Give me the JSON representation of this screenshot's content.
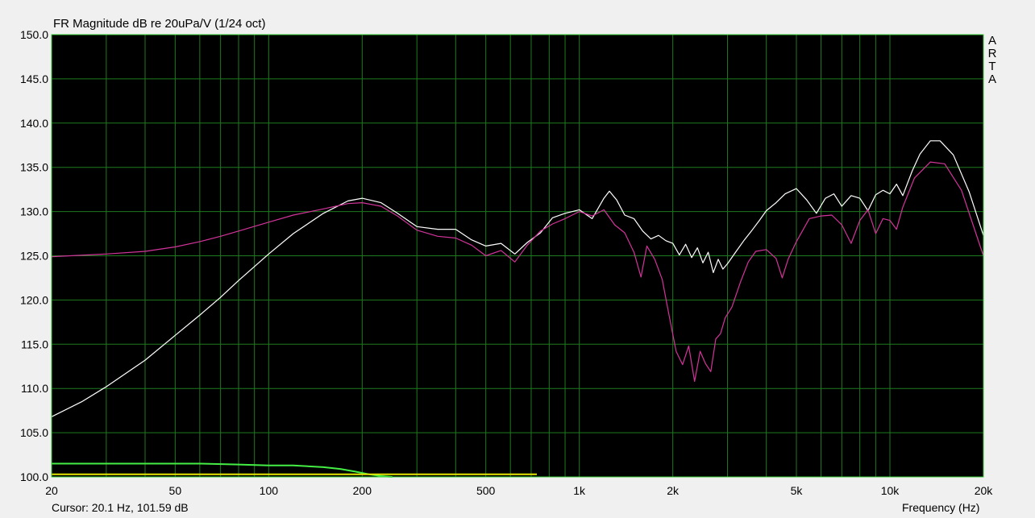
{
  "watermark": "ARTA",
  "cursor_readout": "Cursor: 20.1 Hz, 101.59 dB",
  "colors": {
    "background": "#000000",
    "grid": "#1e7a1e",
    "frame": "#33cc33",
    "series_white": "#ffffff",
    "series_magenta": "#d2349a",
    "coherence_green": "#44ee44",
    "coherence_yellow": "#e6e600"
  },
  "chart_data": {
    "type": "line",
    "title": "FR Magnitude dB re 20uPa/V (1/24 oct)",
    "xlabel": "Frequency (Hz)",
    "ylabel": "",
    "xscale": "log",
    "xlim": [
      20,
      20000
    ],
    "ylim": [
      100,
      150
    ],
    "grid": true,
    "x_ticks": [
      20,
      50,
      100,
      200,
      500,
      1000,
      2000,
      5000,
      10000,
      20000
    ],
    "x_tick_labels": [
      "20",
      "50",
      "100",
      "200",
      "500",
      "1k",
      "2k",
      "5k",
      "10k",
      "20k"
    ],
    "y_ticks": [
      100,
      105,
      110,
      115,
      120,
      125,
      130,
      135,
      140,
      145,
      150
    ],
    "y_tick_labels": [
      "100.0",
      "105.0",
      "110.0",
      "115.0",
      "120.0",
      "125.0",
      "130.0",
      "135.0",
      "140.0",
      "145.0",
      "150.0"
    ],
    "series": [
      {
        "color": "#ffffff",
        "points": [
          [
            20,
            106.8
          ],
          [
            25,
            108.5
          ],
          [
            30,
            110.2
          ],
          [
            40,
            113.2
          ],
          [
            50,
            116.0
          ],
          [
            60,
            118.3
          ],
          [
            70,
            120.3
          ],
          [
            80,
            122.2
          ],
          [
            100,
            125.2
          ],
          [
            120,
            127.5
          ],
          [
            150,
            129.8
          ],
          [
            180,
            131.2
          ],
          [
            200,
            131.5
          ],
          [
            230,
            131.0
          ],
          [
            260,
            129.8
          ],
          [
            300,
            128.3
          ],
          [
            350,
            128.0
          ],
          [
            400,
            128.0
          ],
          [
            450,
            126.8
          ],
          [
            500,
            126.1
          ],
          [
            560,
            126.4
          ],
          [
            620,
            125.2
          ],
          [
            680,
            126.5
          ],
          [
            750,
            127.6
          ],
          [
            820,
            129.3
          ],
          [
            900,
            129.8
          ],
          [
            1000,
            130.2
          ],
          [
            1100,
            129.2
          ],
          [
            1200,
            131.5
          ],
          [
            1250,
            132.3
          ],
          [
            1320,
            131.3
          ],
          [
            1400,
            129.6
          ],
          [
            1500,
            129.2
          ],
          [
            1600,
            127.8
          ],
          [
            1700,
            126.9
          ],
          [
            1800,
            127.3
          ],
          [
            1900,
            126.7
          ],
          [
            2000,
            126.4
          ],
          [
            2100,
            125.1
          ],
          [
            2200,
            126.3
          ],
          [
            2300,
            124.8
          ],
          [
            2400,
            125.9
          ],
          [
            2500,
            124.2
          ],
          [
            2600,
            125.4
          ],
          [
            2700,
            123.1
          ],
          [
            2800,
            124.6
          ],
          [
            2900,
            123.5
          ],
          [
            3000,
            124.1
          ],
          [
            3200,
            125.5
          ],
          [
            3400,
            126.8
          ],
          [
            3600,
            127.9
          ],
          [
            3800,
            129.0
          ],
          [
            4000,
            130.1
          ],
          [
            4300,
            131.0
          ],
          [
            4600,
            132.0
          ],
          [
            5000,
            132.6
          ],
          [
            5400,
            131.3
          ],
          [
            5800,
            129.8
          ],
          [
            6200,
            131.5
          ],
          [
            6600,
            132.0
          ],
          [
            7000,
            130.6
          ],
          [
            7500,
            131.8
          ],
          [
            8000,
            131.5
          ],
          [
            8500,
            130.1
          ],
          [
            9000,
            131.9
          ],
          [
            9500,
            132.4
          ],
          [
            10000,
            132.0
          ],
          [
            10500,
            133.1
          ],
          [
            11000,
            131.8
          ],
          [
            11800,
            134.6
          ],
          [
            12500,
            136.5
          ],
          [
            13500,
            138.0
          ],
          [
            14500,
            138.0
          ],
          [
            16000,
            136.4
          ],
          [
            18000,
            132.2
          ],
          [
            20000,
            127.3
          ]
        ]
      },
      {
        "color": "#d2349a",
        "points": [
          [
            20,
            124.9
          ],
          [
            30,
            125.2
          ],
          [
            40,
            125.5
          ],
          [
            50,
            126.0
          ],
          [
            60,
            126.6
          ],
          [
            70,
            127.2
          ],
          [
            80,
            127.8
          ],
          [
            100,
            128.8
          ],
          [
            120,
            129.6
          ],
          [
            150,
            130.3
          ],
          [
            180,
            130.9
          ],
          [
            200,
            131.0
          ],
          [
            230,
            130.6
          ],
          [
            260,
            129.5
          ],
          [
            300,
            127.9
          ],
          [
            350,
            127.2
          ],
          [
            400,
            127.0
          ],
          [
            450,
            126.2
          ],
          [
            500,
            125.0
          ],
          [
            560,
            125.6
          ],
          [
            620,
            124.3
          ],
          [
            680,
            126.2
          ],
          [
            750,
            127.8
          ],
          [
            820,
            128.6
          ],
          [
            900,
            129.2
          ],
          [
            1000,
            130.0
          ],
          [
            1100,
            129.5
          ],
          [
            1200,
            130.2
          ],
          [
            1300,
            128.5
          ],
          [
            1400,
            127.6
          ],
          [
            1500,
            125.4
          ],
          [
            1580,
            122.6
          ],
          [
            1650,
            126.1
          ],
          [
            1750,
            124.6
          ],
          [
            1850,
            122.3
          ],
          [
            1950,
            118.1
          ],
          [
            2050,
            114.2
          ],
          [
            2150,
            112.7
          ],
          [
            2250,
            114.8
          ],
          [
            2350,
            110.8
          ],
          [
            2450,
            114.2
          ],
          [
            2550,
            112.8
          ],
          [
            2650,
            111.9
          ],
          [
            2750,
            115.6
          ],
          [
            2850,
            116.2
          ],
          [
            2950,
            118.0
          ],
          [
            3100,
            119.2
          ],
          [
            3300,
            122.0
          ],
          [
            3500,
            124.3
          ],
          [
            3700,
            125.5
          ],
          [
            4000,
            125.7
          ],
          [
            4300,
            124.7
          ],
          [
            4500,
            122.5
          ],
          [
            4700,
            124.6
          ],
          [
            5000,
            126.6
          ],
          [
            5500,
            129.2
          ],
          [
            6000,
            129.5
          ],
          [
            6500,
            129.6
          ],
          [
            7000,
            128.5
          ],
          [
            7500,
            126.4
          ],
          [
            8000,
            129.0
          ],
          [
            8500,
            130.2
          ],
          [
            9000,
            127.5
          ],
          [
            9500,
            129.2
          ],
          [
            10000,
            129.0
          ],
          [
            10500,
            128.0
          ],
          [
            11000,
            130.5
          ],
          [
            12000,
            133.8
          ],
          [
            13500,
            135.6
          ],
          [
            15000,
            135.4
          ],
          [
            17000,
            132.4
          ],
          [
            20000,
            125.0
          ]
        ]
      },
      {
        "color": "#44ee44",
        "points": [
          [
            20,
            101.5
          ],
          [
            50,
            101.5
          ],
          [
            60,
            101.5
          ],
          [
            80,
            101.4
          ],
          [
            100,
            101.3
          ],
          [
            120,
            101.3
          ],
          [
            150,
            101.1
          ],
          [
            170,
            100.9
          ],
          [
            190,
            100.6
          ],
          [
            210,
            100.3
          ],
          [
            230,
            100.1
          ],
          [
            250,
            100.0
          ]
        ]
      },
      {
        "color": "#e6e600",
        "points": [
          [
            20,
            100.3
          ],
          [
            100,
            100.3
          ],
          [
            300,
            100.3
          ],
          [
            600,
            100.3
          ],
          [
            730,
            100.3
          ]
        ]
      }
    ]
  }
}
